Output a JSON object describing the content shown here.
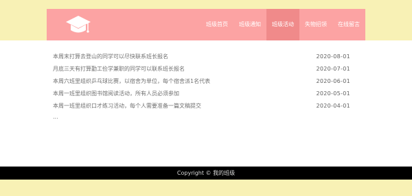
{
  "logo_icon": "graduation-cap-icon",
  "nav": {
    "items": [
      {
        "label": "班级首页"
      },
      {
        "label": "班级通知"
      },
      {
        "label": "班级活动"
      },
      {
        "label": "失物招领"
      },
      {
        "label": "在线留言"
      }
    ],
    "active": "班级活动"
  },
  "activities": [
    {
      "title": "本周末打算去登山的同学可以尽快联系班长报名",
      "date": "2020-08-01"
    },
    {
      "title": "月底三天有打算勤工俭学兼职的同学可以联系班长报名",
      "date": "2020-07-01"
    },
    {
      "title": "本周六班里组织乒乓球比赛，以宿舍为单位，每个宿舍派1名代表",
      "date": "2020-06-01"
    },
    {
      "title": "本周一班里组织图书馆阅读活动，所有人员必须参加",
      "date": "2020-05-01"
    },
    {
      "title": "本周一班里组织口才练习活动，每个人需要准备一篇文稿提交",
      "date": "2020-04-01"
    }
  ],
  "more": "...",
  "footer": {
    "text": "Copyright © 我的班级"
  },
  "colors": {
    "top_band": "#f8f1b5",
    "header": "#fca3a3",
    "nav_active": "#f08a8a",
    "footer": "#000000"
  }
}
